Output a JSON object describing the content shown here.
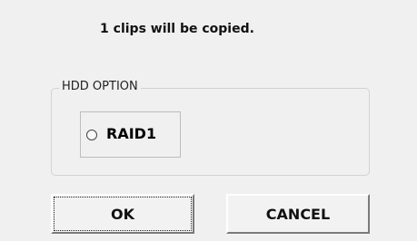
{
  "dialog": {
    "message": "1 clips will be copied.",
    "group": {
      "legend": "HDD OPTION",
      "option_label": "RAID1",
      "option_selected": false
    },
    "buttons": {
      "ok_label": "OK",
      "cancel_label": "CANCEL"
    }
  }
}
